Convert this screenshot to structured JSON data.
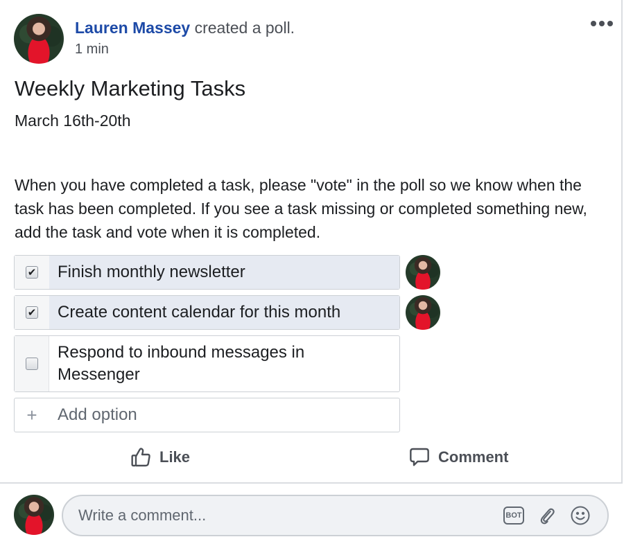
{
  "post": {
    "author": "Lauren Massey",
    "action_text": "created a poll.",
    "timestamp": "1 min",
    "more_icon": "more-horizontal-icon",
    "title": "Weekly Marketing Tasks",
    "subtitle": "March 16th-20th",
    "body": "When you have completed a task, please \"vote\" in the poll so we know when the task has been completed. If you see a task missing or completed something new, add the task and vote when it is completed."
  },
  "poll": {
    "options": [
      {
        "label": "Finish monthly newsletter",
        "checked": true,
        "voters": 1
      },
      {
        "label": "Create content calendar for this month",
        "checked": true,
        "voters": 1
      },
      {
        "label": "Respond to inbound messages in Messenger",
        "checked": false,
        "voters": 0
      }
    ],
    "add_option_placeholder": "Add option",
    "check_glyph": "✔"
  },
  "actions": {
    "like_label": "Like",
    "comment_label": "Comment"
  },
  "composer": {
    "placeholder": "Write a comment...",
    "bot_label": "BOT"
  },
  "colors": {
    "author_link": "#1d4aa7",
    "voted_bg": "#e6eaf2",
    "icon_gray": "#606770"
  }
}
